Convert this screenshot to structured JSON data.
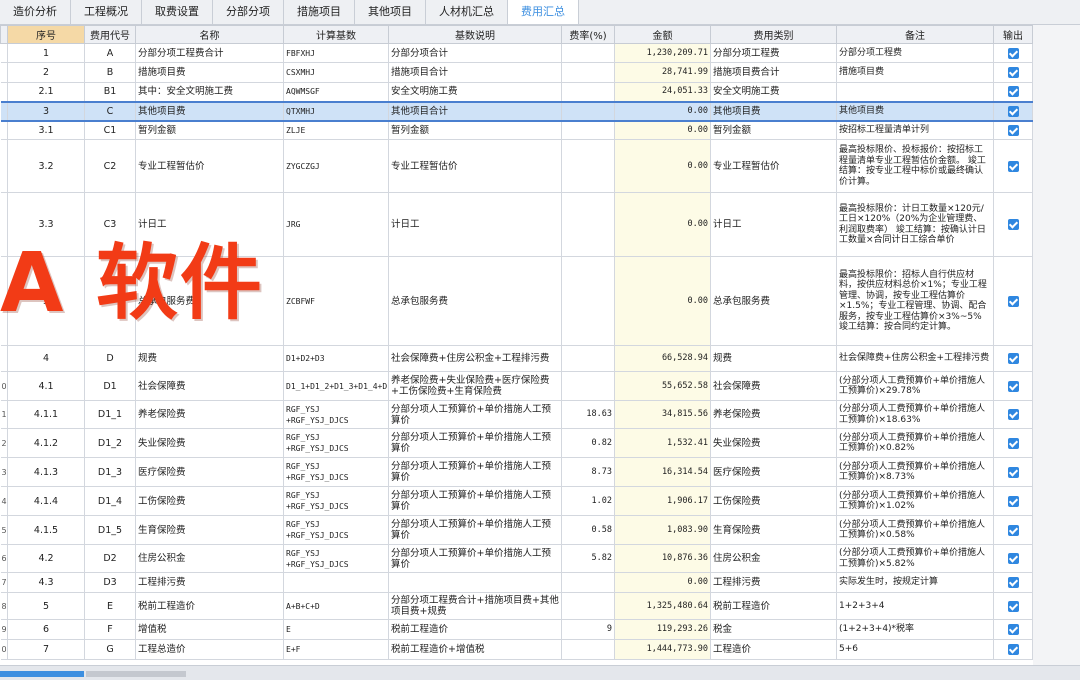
{
  "tabs": [
    "造价分析",
    "工程概况",
    "取费设置",
    "分部分项",
    "措施项目",
    "其他项目",
    "人材机汇总",
    "费用汇总"
  ],
  "active_tab": "费用汇总",
  "columns": [
    "序号",
    "费用代号",
    "名称",
    "计算基数",
    "基数说明",
    "费率(%)",
    "金额",
    "费用类别",
    "备注",
    "输出"
  ],
  "rows": [
    {
      "rn": "",
      "seq": "1",
      "code": "A",
      "name": "分部分项工程费合计",
      "base": "FBFXHJ",
      "base_desc": "分部分项合计",
      "rate": "",
      "amount": "1,230,209.71",
      "category": "分部分项工程费",
      "note": "分部分项工程费"
    },
    {
      "rn": "",
      "seq": "2",
      "code": "B",
      "name": "措施项目费",
      "base": "CSXMHJ",
      "base_desc": "措施项目合计",
      "rate": "",
      "amount": "28,741.99",
      "category": "措施项目费合计",
      "note": "措施项目费"
    },
    {
      "rn": "",
      "seq": "2.1",
      "code": "B1",
      "name": "其中：安全文明施工费",
      "base": "AQWMSGF",
      "base_desc": "安全文明施工费",
      "rate": "",
      "amount": "24,051.33",
      "category": "安全文明施工费",
      "note": ""
    },
    {
      "rn": "",
      "seq": "3",
      "code": "C",
      "name": "其他项目费",
      "base": "QTXMHJ",
      "base_desc": "其他项目合计",
      "rate": "",
      "amount": "0.00",
      "category": "其他项目费",
      "note": "其他项目费"
    },
    {
      "rn": "",
      "seq": "3.1",
      "code": "C1",
      "name": "暂列金额",
      "base": "ZLJE",
      "base_desc": "暂列金额",
      "rate": "",
      "amount": "0.00",
      "category": "暂列金额",
      "note": "按招标工程量清单计列"
    },
    {
      "rn": "",
      "seq": "3.2",
      "code": "C2",
      "name": "专业工程暂估价",
      "base": "ZYGCZGJ",
      "base_desc": "专业工程暂估价",
      "rate": "",
      "amount": "0.00",
      "category": "专业工程暂估价",
      "note": "最高投标限价、投标报价：按招标工程量清单专业工程暂估价金额。 竣工结算：按专业工程中标价或最终确认价计算。"
    },
    {
      "rn": "",
      "seq": "3.3",
      "code": "C3",
      "name": "计日工",
      "base": "JRG",
      "base_desc": "计日工",
      "rate": "",
      "amount": "0.00",
      "category": "计日工",
      "note": "最高投标限价：计日工数量×120元/工日×120%（20%为企业管理费、利润取费率） 竣工结算：按确认计日工数量×合同计日工综合单价"
    },
    {
      "rn": "",
      "seq": "3",
      "code": "",
      "name": "总承包服务费",
      "base": "ZCBFWF",
      "base_desc": "总承包服务费",
      "rate": "",
      "amount": "0.00",
      "category": "总承包服务费",
      "note": "最高投标限价：招标人自行供应材料，按供应材料总价×1%；专业工程管理、协调，按专业工程估算价×1.5%；专业工程管理、协调、配合服务，按专业工程估算价×3%~5% 竣工结算：按合同约定计算。"
    },
    {
      "rn": "",
      "seq": "4",
      "code": "D",
      "name": "规费",
      "base": "D1+D2+D3",
      "base_desc": "社会保障费+住房公积金+工程排污费",
      "rate": "",
      "amount": "66,528.94",
      "category": "规费",
      "note": "社会保障费+住房公积金+工程排污费"
    },
    {
      "rn": "0",
      "seq": "4.1",
      "code": "D1",
      "name": "社会保障费",
      "base": "D1_1+D1_2+D1_3+D1_4+D1_5",
      "base_desc": "养老保险费+失业保险费+医疗保险费+工伤保险费+生育保险费",
      "rate": "",
      "amount": "55,652.58",
      "category": "社会保障费",
      "note": "(分部分项人工费预算价+单价措施人工预算价)×29.78%"
    },
    {
      "rn": "1",
      "seq": "4.1.1",
      "code": "D1_1",
      "name": "养老保险费",
      "base": "RGF_YSJ +RGF_YSJ_DJCS",
      "base_desc": "分部分项人工预算价+单价措施人工预算价",
      "rate": "18.63",
      "amount": "34,815.56",
      "category": "养老保险费",
      "note": "(分部分项人工费预算价+单价措施人工预算价)×18.63%"
    },
    {
      "rn": "2",
      "seq": "4.1.2",
      "code": "D1_2",
      "name": "失业保险费",
      "base": "RGF_YSJ +RGF_YSJ_DJCS",
      "base_desc": "分部分项人工预算价+单价措施人工预算价",
      "rate": "0.82",
      "amount": "1,532.41",
      "category": "失业保险费",
      "note": "(分部分项人工费预算价+单价措施人工预算价)×0.82%"
    },
    {
      "rn": "3",
      "seq": "4.1.3",
      "code": "D1_3",
      "name": "医疗保险费",
      "base": "RGF_YSJ +RGF_YSJ_DJCS",
      "base_desc": "分部分项人工预算价+单价措施人工预算价",
      "rate": "8.73",
      "amount": "16,314.54",
      "category": "医疗保险费",
      "note": "(分部分项人工费预算价+单价措施人工预算价)×8.73%"
    },
    {
      "rn": "4",
      "seq": "4.1.4",
      "code": "D1_4",
      "name": "工伤保险费",
      "base": "RGF_YSJ +RGF_YSJ_DJCS",
      "base_desc": "分部分项人工预算价+单价措施人工预算价",
      "rate": "1.02",
      "amount": "1,906.17",
      "category": "工伤保险费",
      "note": "(分部分项人工费预算价+单价措施人工预算价)×1.02%"
    },
    {
      "rn": "5",
      "seq": "4.1.5",
      "code": "D1_5",
      "name": "生育保险费",
      "base": "RGF_YSJ +RGF_YSJ_DJCS",
      "base_desc": "分部分项人工预算价+单价措施人工预算价",
      "rate": "0.58",
      "amount": "1,083.90",
      "category": "生育保险费",
      "note": "(分部分项人工费预算价+单价措施人工预算价)×0.58%"
    },
    {
      "rn": "6",
      "seq": "4.2",
      "code": "D2",
      "name": "住房公积金",
      "base": "RGF_YSJ +RGF_YSJ_DJCS",
      "base_desc": "分部分项人工预算价+单价措施人工预算价",
      "rate": "5.82",
      "amount": "10,876.36",
      "category": "住房公积金",
      "note": "(分部分项人工费预算价+单价措施人工预算价)×5.82%"
    },
    {
      "rn": "7",
      "seq": "4.3",
      "code": "D3",
      "name": "工程排污费",
      "base": "",
      "base_desc": "",
      "rate": "",
      "amount": "0.00",
      "category": "工程排污费",
      "note": "实际发生时，按规定计算"
    },
    {
      "rn": "8",
      "seq": "5",
      "code": "E",
      "name": "税前工程造价",
      "base": "A+B+C+D",
      "base_desc": "分部分项工程费合计+措施项目费+其他项目费+规费",
      "rate": "",
      "amount": "1,325,480.64",
      "category": "税前工程造价",
      "note": "1+2+3+4"
    },
    {
      "rn": "9",
      "seq": "6",
      "code": "F",
      "name": "增值税",
      "base": "E",
      "base_desc": "税前工程造价",
      "rate": "9",
      "amount": "119,293.26",
      "category": "税金",
      "note": "(1+2+3+4)*税率"
    },
    {
      "rn": "0",
      "seq": "7",
      "code": "G",
      "name": "工程总造价",
      "base": "E+F",
      "base_desc": "税前工程造价+增值税",
      "rate": "",
      "amount": "1,444,773.90",
      "category": "工程造价",
      "note": "5+6"
    }
  ],
  "watermark": "A 软件",
  "colors": {
    "accent": "#3d8fe0",
    "checkbox": "#2f87e0",
    "amount_bg": "#fdfbe6",
    "selected_row": "#cfe2f7",
    "watermark": "#f23b16"
  }
}
